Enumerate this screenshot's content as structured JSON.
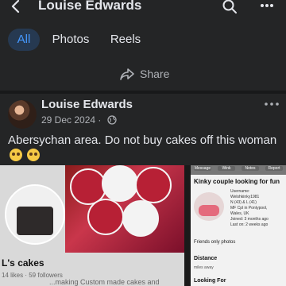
{
  "header": {
    "title": "Louise Edwards",
    "icons": [
      "back-icon",
      "search-icon",
      "more-icon"
    ]
  },
  "tabs": [
    {
      "label": "All",
      "active": true
    },
    {
      "label": "Photos",
      "active": false
    },
    {
      "label": "Reels",
      "active": false
    }
  ],
  "share": {
    "label": "Share",
    "icon": "share-icon"
  },
  "post": {
    "author": "Louise Edwards",
    "date": "29 Dec 2024 · ",
    "privacy_icon": "globe-icon",
    "text": "Abersychan area.   Do not buy cakes off this woman",
    "emojis": [
      "worried-face",
      "worried-face"
    ]
  },
  "media": {
    "left": {
      "shop_name": "L's cakes",
      "stats": "14 likes  ·  59 followers",
      "description": "...making Custom made cakes and"
    },
    "right": {
      "tabs": [
        "Message",
        "Wink",
        "Notes",
        "Report"
      ],
      "title": "Kinky couple looking for fun",
      "info_lines": [
        "Username:",
        "Welshkinky1981",
        "N (43) & L (41)",
        "MF Cpl in Pontypool,",
        "Wales, UK",
        "Joined: 3 months ago",
        "Last on: 2 weeks ago"
      ],
      "friends_label": "Friends only photos",
      "distance_label": "Distance",
      "distance_value": "miles away",
      "looking_label": "Looking For"
    }
  },
  "colors": {
    "background": "#242526",
    "accent": "#4599ff",
    "tab_active_bg": "#263951",
    "muted": "#b0b3b8"
  }
}
